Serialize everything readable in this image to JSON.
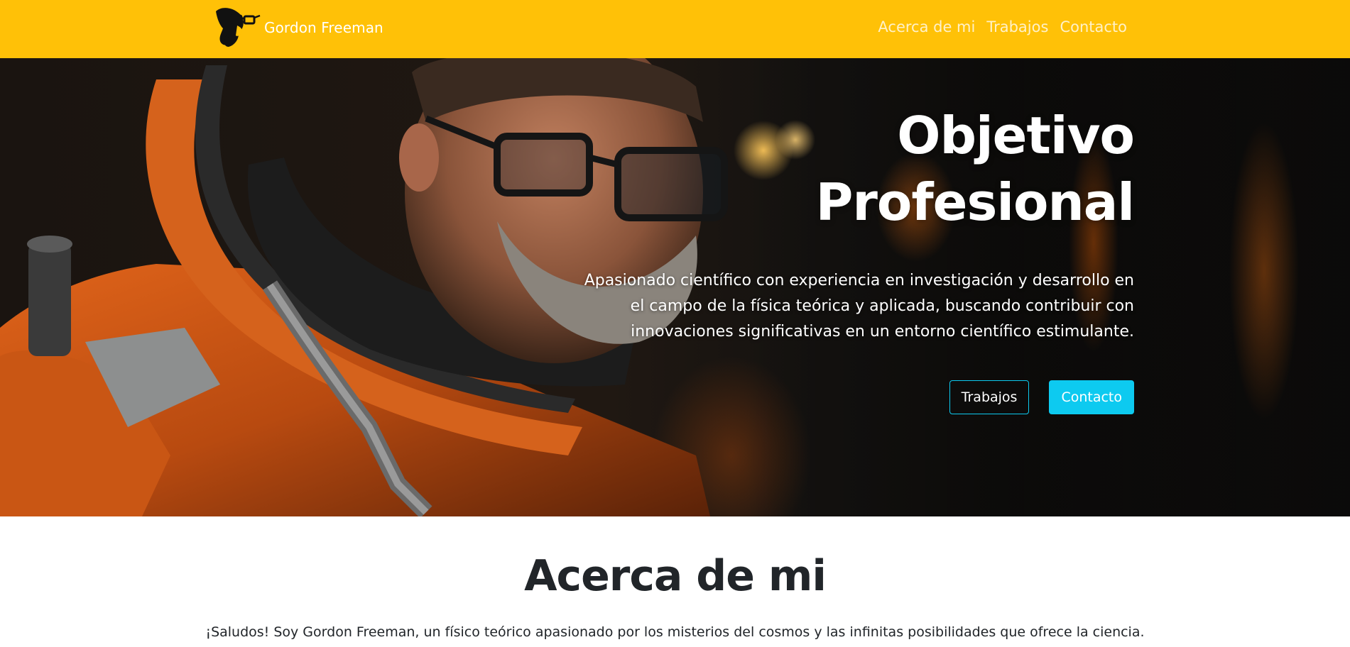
{
  "navbar": {
    "brand": "Gordon Freeman",
    "logo_icon": "glasses-face-logo-icon",
    "links": [
      "Acerca de mi",
      "Trabajos",
      "Contacto"
    ]
  },
  "hero": {
    "title_line1": "Objetivo",
    "title_line2": "Profesional",
    "description": "Apasionado científico con experiencia en investigación y desarrollo en el campo de la física teórica y aplicada, buscando contribuir con innovaciones significativas en un entorno científico estimulante.",
    "buttons": [
      "Trabajos",
      "Contacto"
    ]
  },
  "about": {
    "title": "Acerca de mi",
    "intro": "¡Saludos! Soy Gordon Freeman, un físico teórico apasionado por los misterios del cosmos y las infinitas posibilidades que ofrece la ciencia."
  },
  "colors": {
    "navbar_bg": "#ffc107",
    "accent": "#0dcaf0",
    "text_dark": "#212529"
  }
}
